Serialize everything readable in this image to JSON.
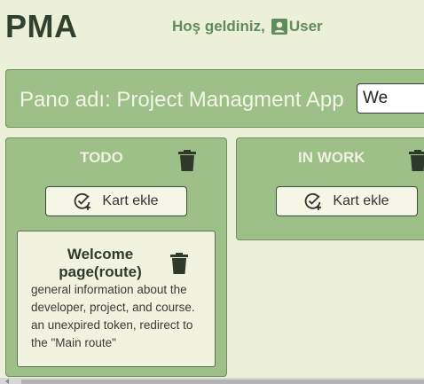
{
  "header": {
    "logo": "PMA",
    "welcome_text": "Hoş geldiniz,",
    "user_icon": "account-box-icon",
    "user_name": "User"
  },
  "board": {
    "title": "Pano adı: Project Managment App",
    "input_value": "We"
  },
  "columns": [
    {
      "title": "TODO",
      "delete_icon": "trash-icon",
      "add_label": "Kart ekle",
      "add_icon": "add-task-icon",
      "cards": [
        {
          "title": "Welcome page(route)",
          "description": "general information about the developer, project, and course. an unexpired token, redirect to the \"Main route\"",
          "delete_icon": "trash-icon"
        }
      ]
    },
    {
      "title": "IN WORK",
      "delete_icon": "trash-icon",
      "add_label": "Kart ekle",
      "add_icon": "add-task-icon",
      "cards": []
    }
  ],
  "colors": {
    "background": "#edf0d8",
    "panel": "#9dbf88",
    "accent": "#5f8c5b",
    "logo": "#31402f"
  }
}
